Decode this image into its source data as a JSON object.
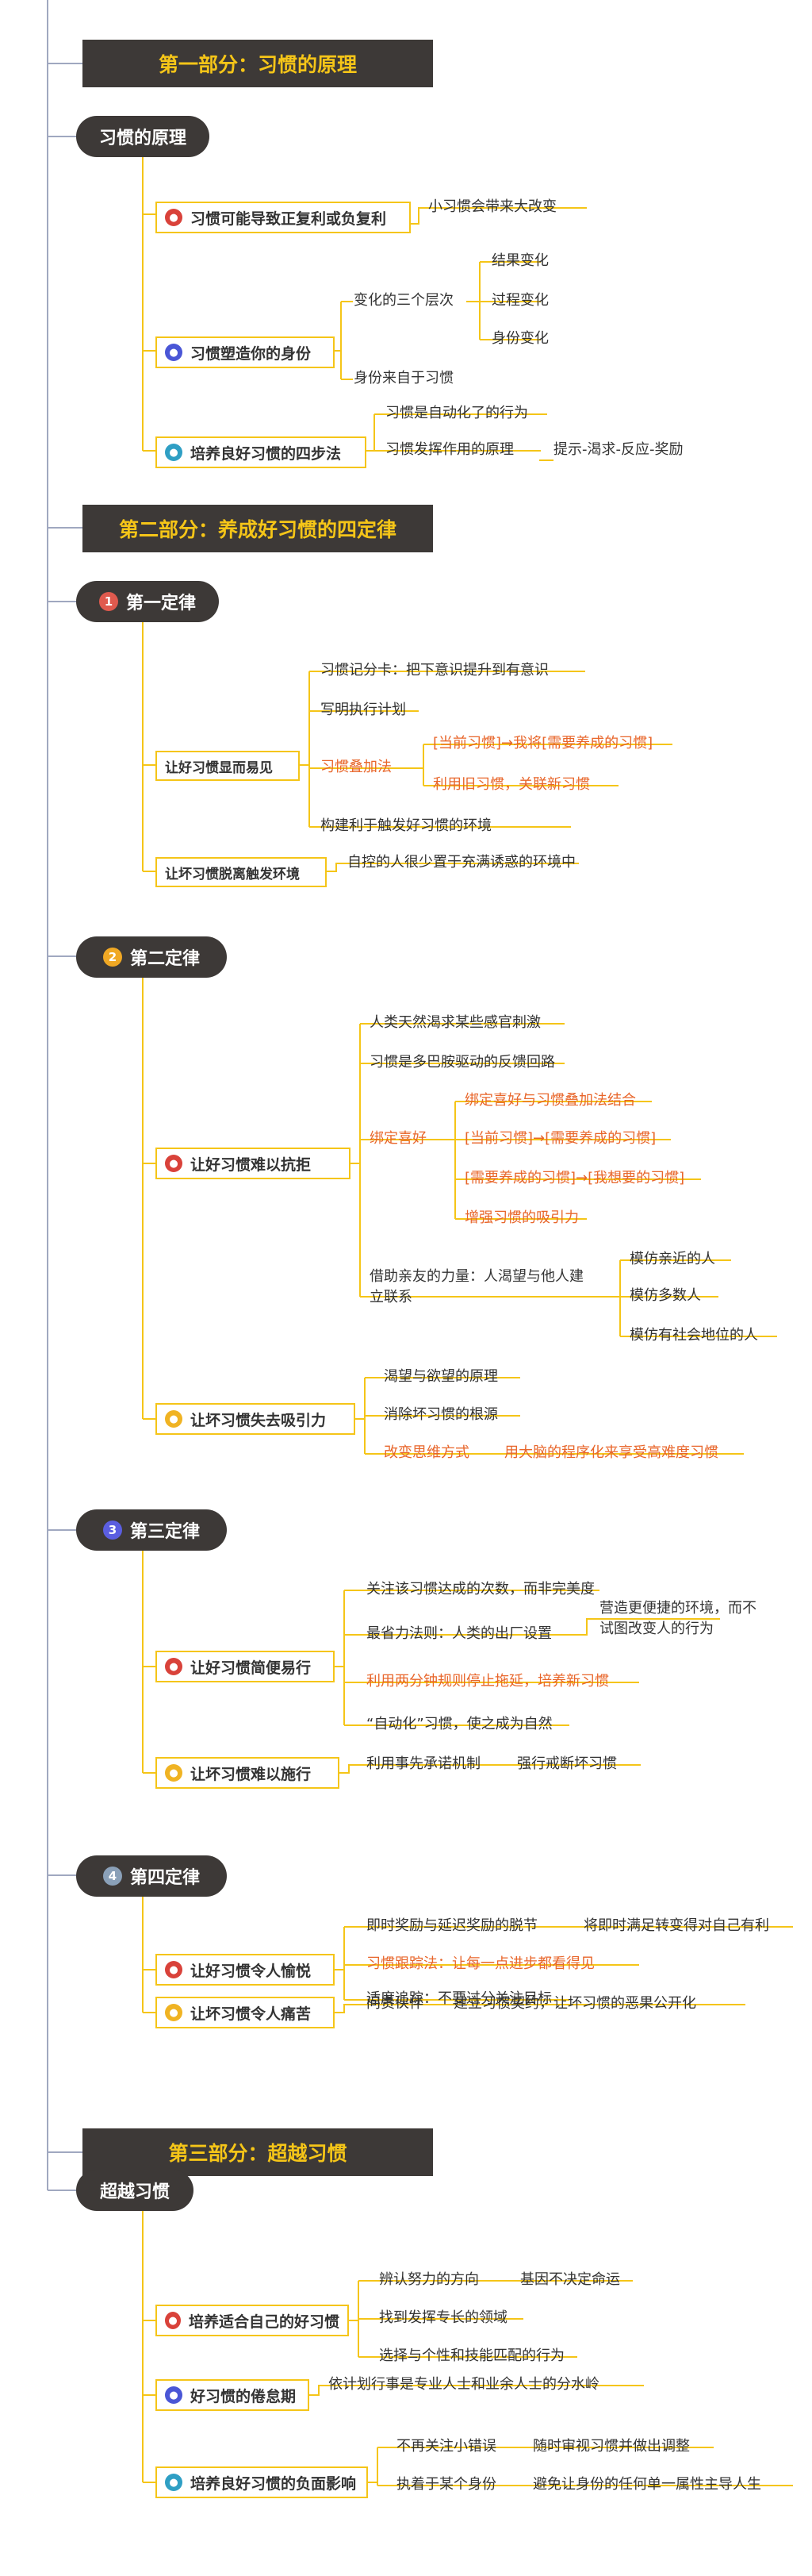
{
  "part1": {
    "title": "第一部分：习惯的原理",
    "node": "习惯的原理",
    "b1": {
      "label": "习惯可能导致正复利或负复利",
      "c1": "小习惯会带来大改变"
    },
    "b2": {
      "label": "习惯塑造你的身份",
      "c1": "变化的三个层次",
      "c1_items": [
        "结果变化",
        "过程变化",
        "身份变化"
      ],
      "c2": "身份来自于习惯"
    },
    "b3": {
      "label": "培养良好习惯的四步法",
      "c1": "习惯是自动化了的行为",
      "c2": "习惯发挥作用的原理",
      "c2_child": "提示-渴求-反应-奖励"
    }
  },
  "part2": {
    "title": "第二部分：养成好习惯的四定律",
    "law1": {
      "num": "1",
      "title": "第一定律",
      "b1": {
        "label": "让好习惯显而易见",
        "items": [
          "习惯记分卡：把下意识提升到有意识",
          "写明执行计划",
          "习惯叠加法",
          "构建利于触发好习惯的环境"
        ],
        "stack_children": [
          "[当前习惯]→我将[需要养成的习惯]",
          "利用旧习惯，关联新习惯"
        ]
      },
      "b2": {
        "label": "让坏习惯脱离触发环境",
        "c1": "自控的人很少置于充满诱惑的环境中"
      }
    },
    "law2": {
      "num": "2",
      "title": "第二定律",
      "b1": {
        "label": "让好习惯难以抗拒",
        "items": [
          "人类天然渴求某些感官刺激",
          "习惯是多巴胺驱动的反馈回路",
          "绑定喜好"
        ],
        "bind_children": [
          "绑定喜好与习惯叠加法结合",
          "[当前习惯]→[需要养成的习惯]",
          "[需要养成的习惯]→[我想要的习惯]",
          "增强习惯的吸引力"
        ],
        "peer_line1": "借助亲友的力量：人渴望与他人建",
        "peer_line2": "立联系",
        "peer_children": [
          "模仿亲近的人",
          "模仿多数人",
          "模仿有社会地位的人"
        ]
      },
      "b2": {
        "label": "让坏习惯失去吸引力",
        "items": [
          "渴望与欲望的原理",
          "消除坏习惯的根源",
          "改变思维方式"
        ],
        "mind_child": "用大脑的程序化来享受高难度习惯"
      }
    },
    "law3": {
      "num": "3",
      "title": "第三定律",
      "b1": {
        "label": "让好习惯简便易行",
        "items": [
          "关注该习惯达成的次数，而非完美度",
          "最省力法则：人类的出厂设置",
          "利用两分钟规则停止拖延，培养新习惯",
          "“自动化”习惯，使之成为自然"
        ],
        "least_child_line1": "营造更便捷的环境，而不",
        "least_child_line2": "试图改变人的行为"
      },
      "b2": {
        "label": "让坏习惯难以施行",
        "c1": "利用事先承诺机制",
        "c1_child": "强行戒断坏习惯"
      }
    },
    "law4": {
      "num": "4",
      "title": "第四定律",
      "b1": {
        "label": "让好习惯令人愉悦",
        "items": [
          "即时奖励与延迟奖励的脱节",
          "习惯跟踪法：让每一点进步都看得见",
          "适度追踪：不要过分关注目标"
        ],
        "delay_child": "将即时满足转变得对自己有利"
      },
      "b2": {
        "label": "让坏习惯令人痛苦",
        "c1": "问责伙伴",
        "c1_child": "建立习惯契约，让坏习惯的恶果公开化"
      }
    }
  },
  "part3": {
    "title": "第三部分：超越习惯",
    "node": "超越习惯",
    "b1": {
      "label": "培养适合自己的好习惯",
      "items": [
        "辨认努力的方向",
        "找到发挥专长的领域",
        "选择与个性和技能匹配的行为"
      ],
      "dir_child": "基因不决定命运"
    },
    "b2": {
      "label": "好习惯的倦怠期",
      "c1": "依计划行事是专业人士和业余人士的分水岭"
    },
    "b3": {
      "label": "培养良好习惯的负面影响",
      "c1": "不再关注小错误",
      "c1_child": "随时审视习惯并做出调整",
      "c2": "执着于某个身份",
      "c2_child": "避免让身份的任何单一属性主导人生"
    }
  },
  "colors": {
    "trunk": "#a0a8c0",
    "branch": "#f5c518",
    "dark": "#3d3937",
    "accent_text": "#e8662b",
    "section_text": "#f5c518"
  }
}
